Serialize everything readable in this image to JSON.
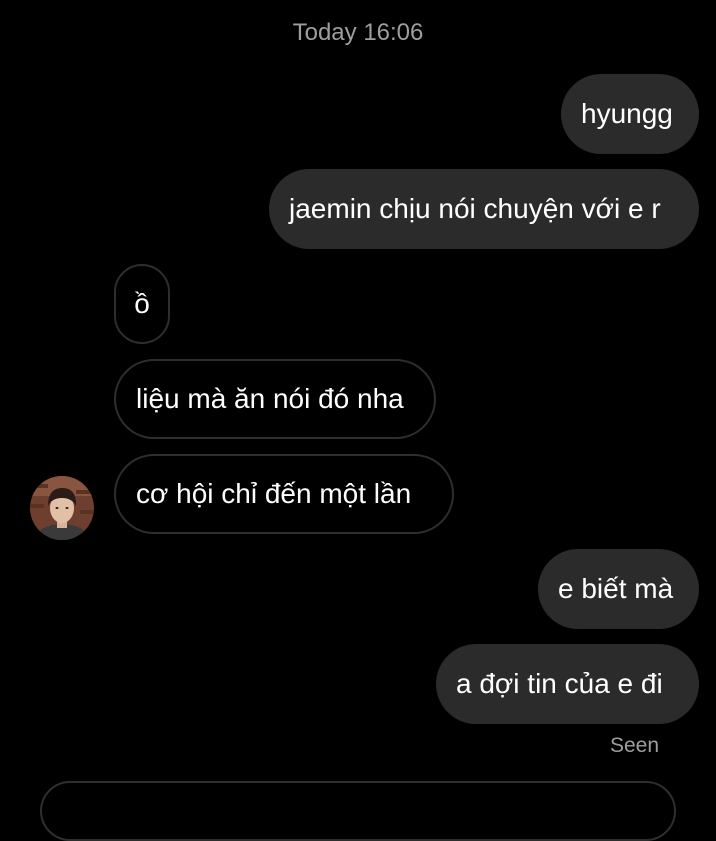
{
  "thread": {
    "timestamp": "Today 16:06",
    "seen_label": "Seen"
  },
  "messages": [
    {
      "side": "outgoing",
      "text": "hyungg"
    },
    {
      "side": "outgoing",
      "text": "jaemin chịu nói chuyện với e r"
    },
    {
      "side": "incoming",
      "text": "ồ"
    },
    {
      "side": "incoming",
      "text": "liệu mà ăn nói đó nha"
    },
    {
      "side": "incoming",
      "text": "cơ hội chỉ đến một lần"
    },
    {
      "side": "outgoing",
      "text": "e biết mà"
    },
    {
      "side": "outgoing",
      "text": "a đợi tin của e đi"
    }
  ],
  "colors": {
    "background": "#000000",
    "outgoing_bubble": "#2b2b2b",
    "incoming_border": "#2e2e2e",
    "muted_text": "#9e9e9e"
  },
  "icons": {
    "avatar": "contact-avatar-photo"
  }
}
